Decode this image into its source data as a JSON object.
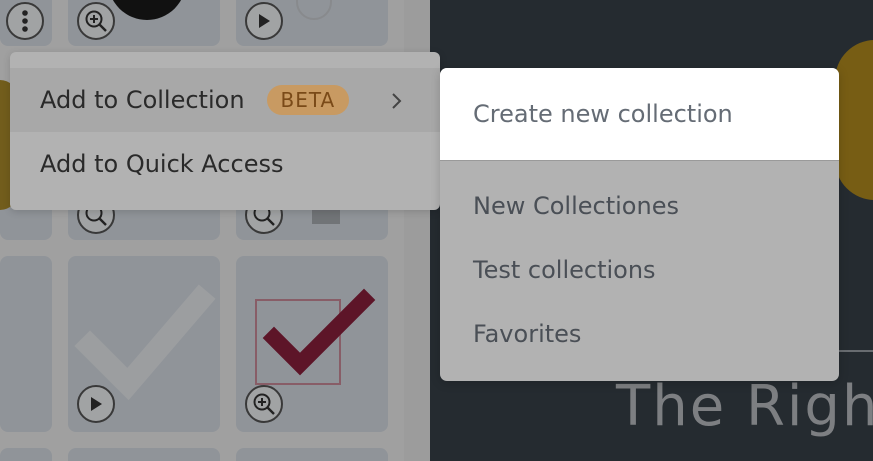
{
  "context_menu": {
    "items": [
      {
        "label": "Add to Collection",
        "badge": "BETA",
        "has_submenu": true
      },
      {
        "label": "Add to Quick Access"
      }
    ]
  },
  "submenu": {
    "create_label": "Create new collection",
    "collections": [
      "New Collectiones",
      "Test collections",
      "Favorites"
    ]
  },
  "preview": {
    "text": "The Righ"
  },
  "colors": {
    "accent_badge": "#c89a62",
    "checkmark": "#8a1f3c",
    "preview_bg": "#374048"
  },
  "icons": {
    "more": "more-vertical-icon",
    "zoom": "zoom-in-icon",
    "play": "play-icon",
    "chevron": "chevron-right-icon",
    "collapse": "chevron-left-icon"
  }
}
